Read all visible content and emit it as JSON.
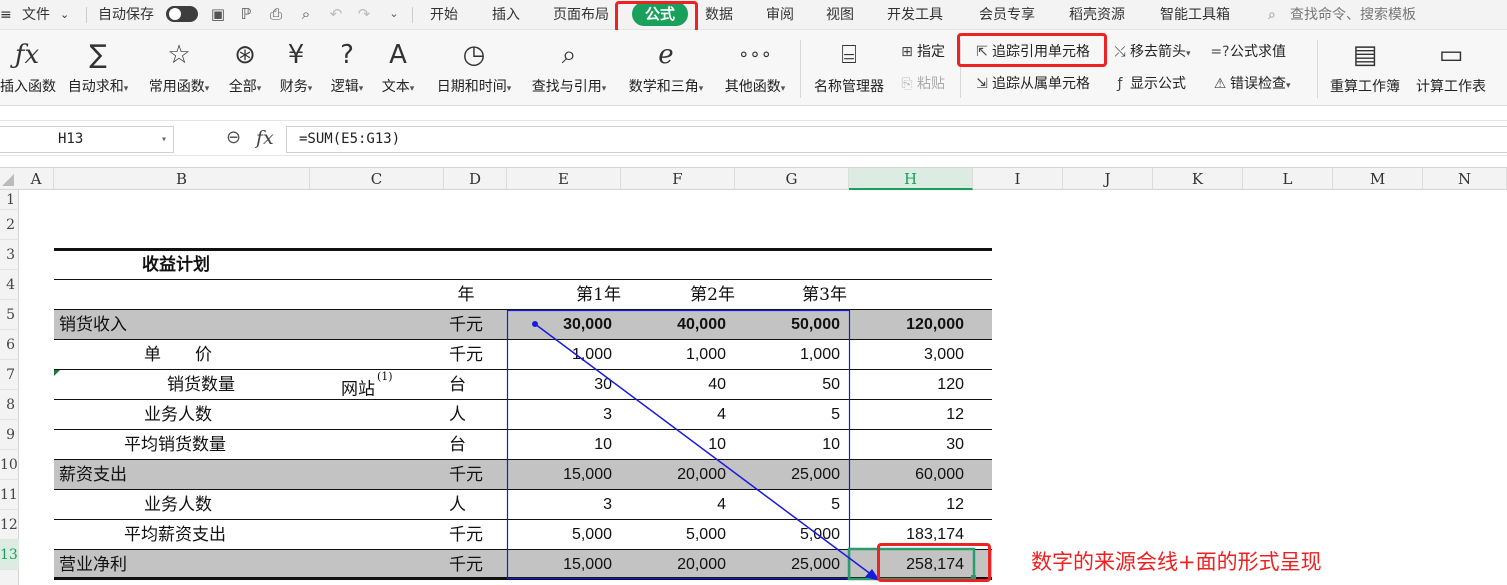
{
  "menu": {
    "file": "文件",
    "autosave": "自动保存",
    "tabs": [
      "开始",
      "插入",
      "页面布局",
      "公式",
      "数据",
      "审阅",
      "视图",
      "开发工具",
      "会员专享",
      "稻壳资源",
      "智能工具箱"
    ],
    "active_tab": "公式",
    "search_placeholder": "查找命令、搜索模板"
  },
  "ribbon": {
    "insert_function": "插入函数",
    "autosum": "自动求和",
    "common_functions": "常用函数",
    "all": "全部",
    "financial": "财务",
    "logical": "逻辑",
    "text": "文本",
    "datetime": "日期和时间",
    "lookup": "查找与引用",
    "math": "数学和三角",
    "other": "其他函数",
    "name_manager": "名称管理器",
    "define": "指定",
    "paste": "粘贴",
    "trace_precedents": "追踪引用单元格",
    "trace_dependents": "追踪从属单元格",
    "remove_arrows": "移去箭头",
    "show_formulas": "显示公式",
    "evaluate": "公式求值",
    "error_check": "错误检查",
    "recalc_workbook": "重算工作簿",
    "calc_sheet": "计算工作表"
  },
  "formula_bar": {
    "name_box": "H13",
    "formula": "=SUM(E5:G13)"
  },
  "columns": [
    "A",
    "B",
    "C",
    "D",
    "E",
    "F",
    "G",
    "H",
    "I",
    "J",
    "K",
    "L",
    "M",
    "N"
  ],
  "selected_column": "H",
  "rows": [
    "1",
    "2",
    "3",
    "4",
    "5",
    "6",
    "7",
    "8",
    "9",
    "10",
    "11",
    "12",
    "13"
  ],
  "selected_row": "13",
  "sheet": {
    "title": "收益计划",
    "year_header": "年",
    "years": [
      "第1年",
      "第2年",
      "第3年"
    ],
    "website_label": "网站",
    "website_note": "(1)",
    "table": [
      {
        "label": "销货收入",
        "unit": "千元",
        "e": "30,000",
        "f": "40,000",
        "g": "50,000",
        "h": "120,000"
      },
      {
        "label": "单　　价",
        "unit": "千元",
        "e": "1,000",
        "f": "1,000",
        "g": "1,000",
        "h": "3,000"
      },
      {
        "label": "销货数量",
        "unit": "台",
        "e": "30",
        "f": "40",
        "g": "50",
        "h": "120"
      },
      {
        "label": "业务人数",
        "unit": "人",
        "e": "3",
        "f": "4",
        "g": "5",
        "h": "12"
      },
      {
        "label": "平均销货数量",
        "unit": "台",
        "e": "10",
        "f": "10",
        "g": "10",
        "h": "30"
      },
      {
        "label": "薪资支出",
        "unit": "千元",
        "e": "15,000",
        "f": "20,000",
        "g": "25,000",
        "h": "60,000"
      },
      {
        "label": "业务人数",
        "unit": "人",
        "e": "3",
        "f": "4",
        "g": "5",
        "h": "12"
      },
      {
        "label": "平均薪资支出",
        "unit": "千元",
        "e": "5,000",
        "f": "5,000",
        "g": "5,000",
        "h": "183,174"
      },
      {
        "label": "营业净利",
        "unit": "千元",
        "e": "15,000",
        "f": "20,000",
        "g": "25,000",
        "h": "258,174"
      }
    ]
  },
  "annotation": "数字的来源会线+面的形式呈现",
  "colors": {
    "accent_green": "#19a05a",
    "highlight_red": "#ee2222",
    "trace_blue": "#1a1adc",
    "band_gray": "#c3c3c3"
  }
}
